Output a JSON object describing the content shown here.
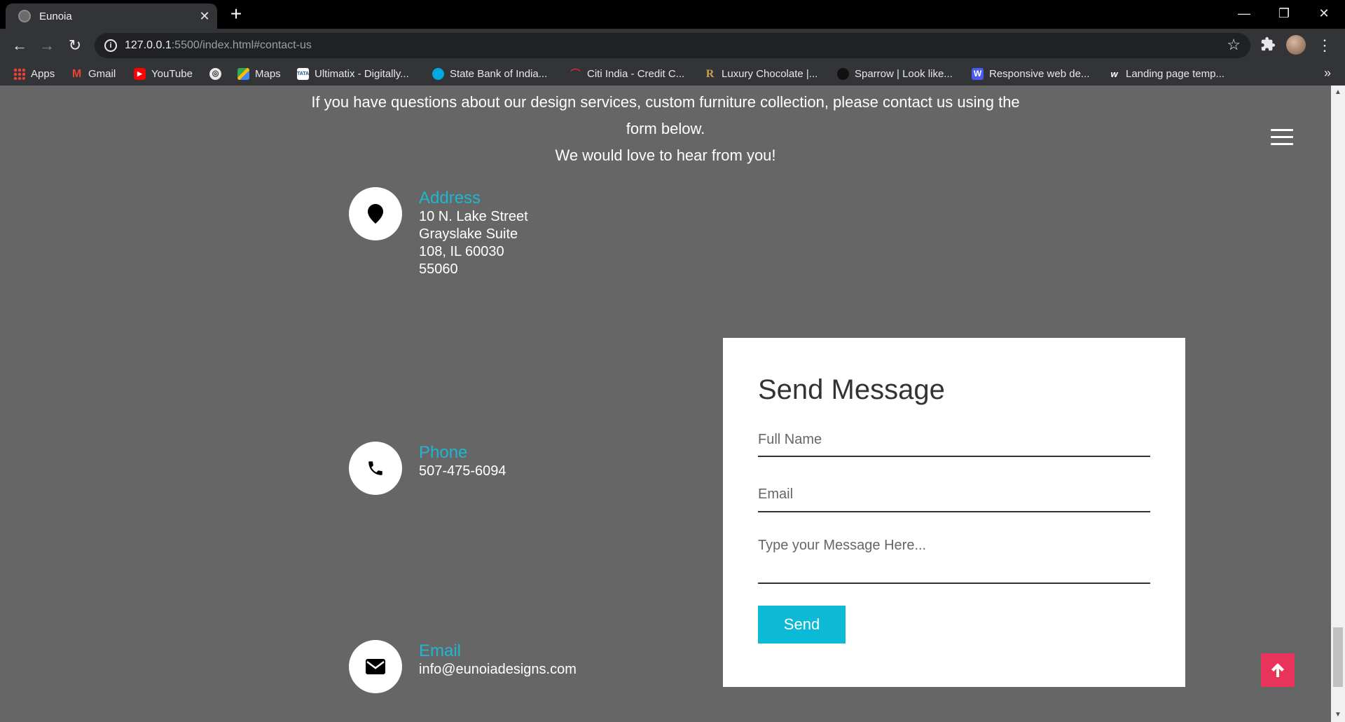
{
  "browser": {
    "tab_title": "Eunoia",
    "url_host": "127.0.0.1",
    "url_rest": ":5500/index.html#contact-us",
    "bookmarks": [
      {
        "label": "Apps"
      },
      {
        "label": "Gmail"
      },
      {
        "label": "YouTube"
      },
      {
        "label": ""
      },
      {
        "label": "Maps"
      },
      {
        "label": "Ultimatix - Digitally..."
      },
      {
        "label": "State Bank of India..."
      },
      {
        "label": "Citi India - Credit C..."
      },
      {
        "label": "Luxury Chocolate |..."
      },
      {
        "label": "Sparrow | Look like..."
      },
      {
        "label": "Responsive web de..."
      },
      {
        "label": "Landing page temp..."
      }
    ],
    "overflow": "»"
  },
  "page": {
    "intro_line1": "If you have questions about our design services, custom furniture collection, please contact us using the form below.",
    "intro_line2": "We would love to hear from you!",
    "address": {
      "label": "Address",
      "value": "10 N. Lake Street Grayslake Suite 108, IL 60030 55060"
    },
    "phone": {
      "label": "Phone",
      "value": "507-475-6094"
    },
    "email": {
      "label": "Email",
      "value": "info@eunoiadesigns.com"
    },
    "form": {
      "title": "Send Message",
      "name_placeholder": "Full Name",
      "email_placeholder": "Email",
      "message_placeholder": "Type your Message Here...",
      "send_label": "Send"
    }
  },
  "colors": {
    "accent": "#1fb6d1",
    "send_button": "#0dbad6",
    "back_to_top": "#e8345b",
    "page_background": "#666666"
  }
}
